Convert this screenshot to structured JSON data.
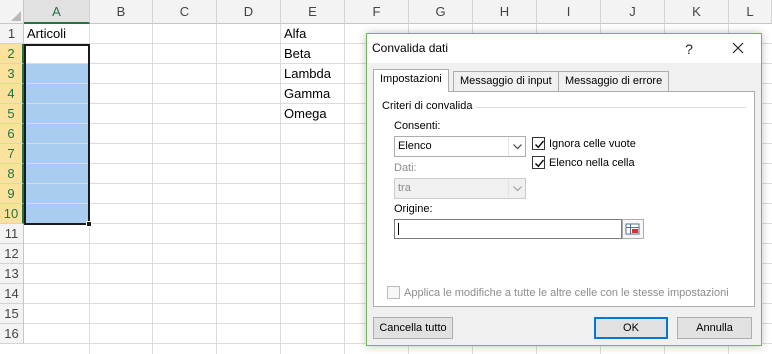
{
  "sheet": {
    "columns": [
      "A",
      "B",
      "C",
      "D",
      "E",
      "F",
      "G",
      "H",
      "I",
      "J",
      "K",
      "L"
    ],
    "rows": [
      "1",
      "2",
      "3",
      "4",
      "5",
      "6",
      "7",
      "8",
      "9",
      "10",
      "11",
      "12",
      "13",
      "14",
      "15",
      "16"
    ],
    "cells": {
      "A1": "Articoli",
      "E1": "Alfa",
      "E2": "Beta",
      "E3": "Lambda",
      "E4": "Gamma",
      "E5": "Omega"
    },
    "selection_color": "#a9cdf0"
  },
  "dialog": {
    "title": "Convalida dati",
    "help": "?",
    "tabs": [
      "Impostazioni",
      "Messaggio di input",
      "Messaggio di errore"
    ],
    "group_title": "Criteri di convalida",
    "allow_label": "Consenti:",
    "allow_value": "Elenco",
    "ignore_blank_label": "Ignora celle vuote",
    "ignore_blank_checked": true,
    "in_cell_dropdown_label": "Elenco nella cella",
    "in_cell_dropdown_checked": true,
    "data_label": "Dati:",
    "data_value": "tra",
    "source_label": "Origine:",
    "source_value": "",
    "apply_all_label": "Applica le modifiche a tutte le altre celle con le stesse impostazioni",
    "apply_all_checked": false,
    "clear_all_label": "Cancella tutto",
    "ok_label": "OK",
    "cancel_label": "Annulla",
    "accent_color": "#0078d7",
    "border_color": "#77b35a"
  }
}
